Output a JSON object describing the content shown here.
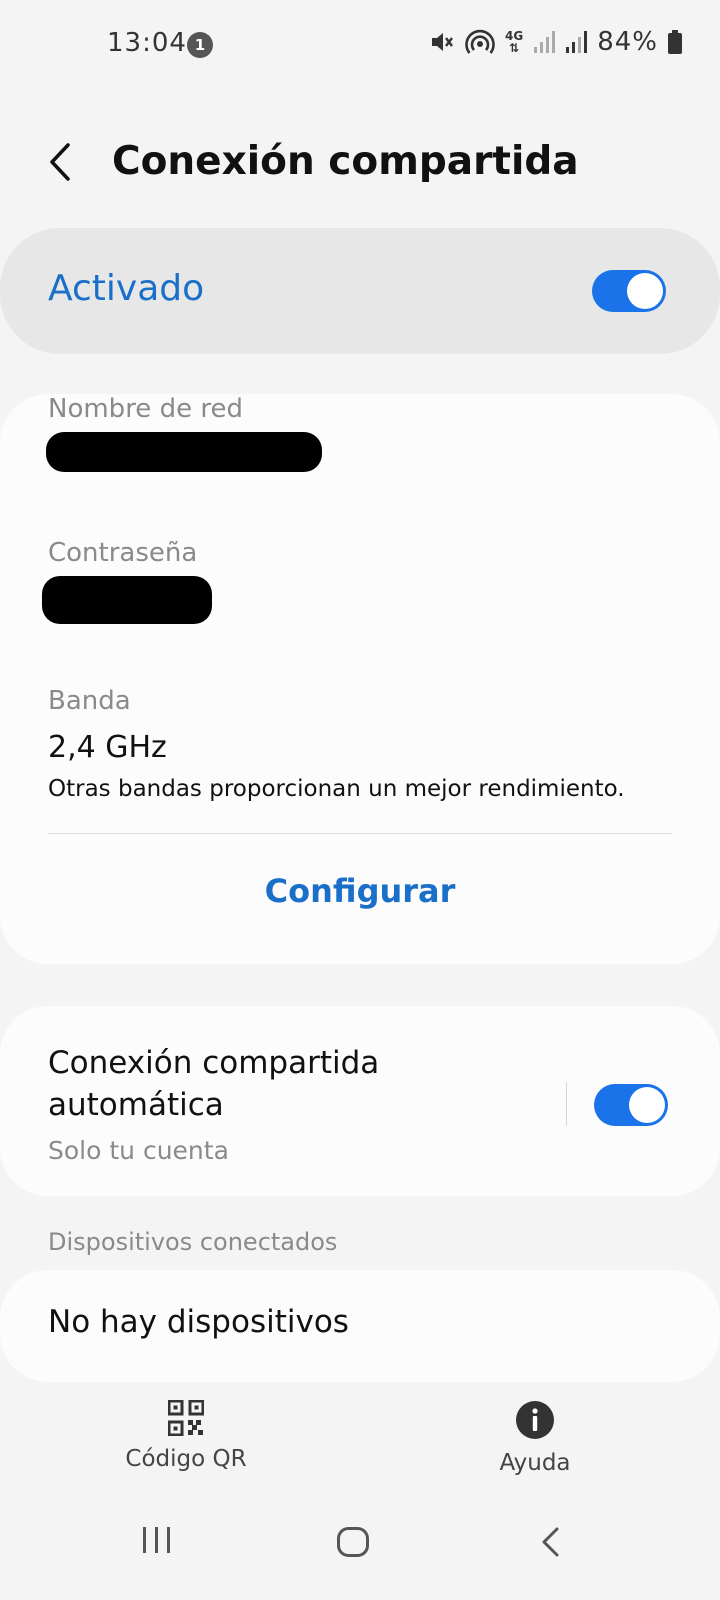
{
  "status_bar": {
    "time": "13:04",
    "notification_count": "1",
    "battery": "84%",
    "network": "4G",
    "icons": [
      "mute-icon",
      "hotspot-icon",
      "4g-data-icon",
      "signal-icon",
      "signal-icon",
      "battery-icon"
    ]
  },
  "header": {
    "title": "Conexión compartida",
    "back_icon": "back-arrow-icon"
  },
  "master_switch": {
    "label": "Activado",
    "on": true
  },
  "network": {
    "name_label": "Nombre de red",
    "password_label": "Contraseña",
    "band_label": "Banda",
    "band_value": "2,4 GHz",
    "band_note": "Otras bandas proporcionan un mejor rendimiento.",
    "configure_label": "Configurar"
  },
  "auto_hotspot": {
    "title": "Conexión compartida automática",
    "subtitle": "Solo tu cuenta",
    "on": true
  },
  "connected_devices": {
    "header": "Dispositivos conectados",
    "empty_text": "No hay dispositivos"
  },
  "bottom_actions": {
    "qr_label": "Código QR",
    "help_label": "Ayuda"
  },
  "nav_bar": {
    "icons": [
      "recents-icon",
      "home-icon",
      "back-icon"
    ]
  },
  "colors": {
    "accent": "#1a73e8",
    "accent_text": "#1a6fc9",
    "background": "#f4f4f4"
  }
}
